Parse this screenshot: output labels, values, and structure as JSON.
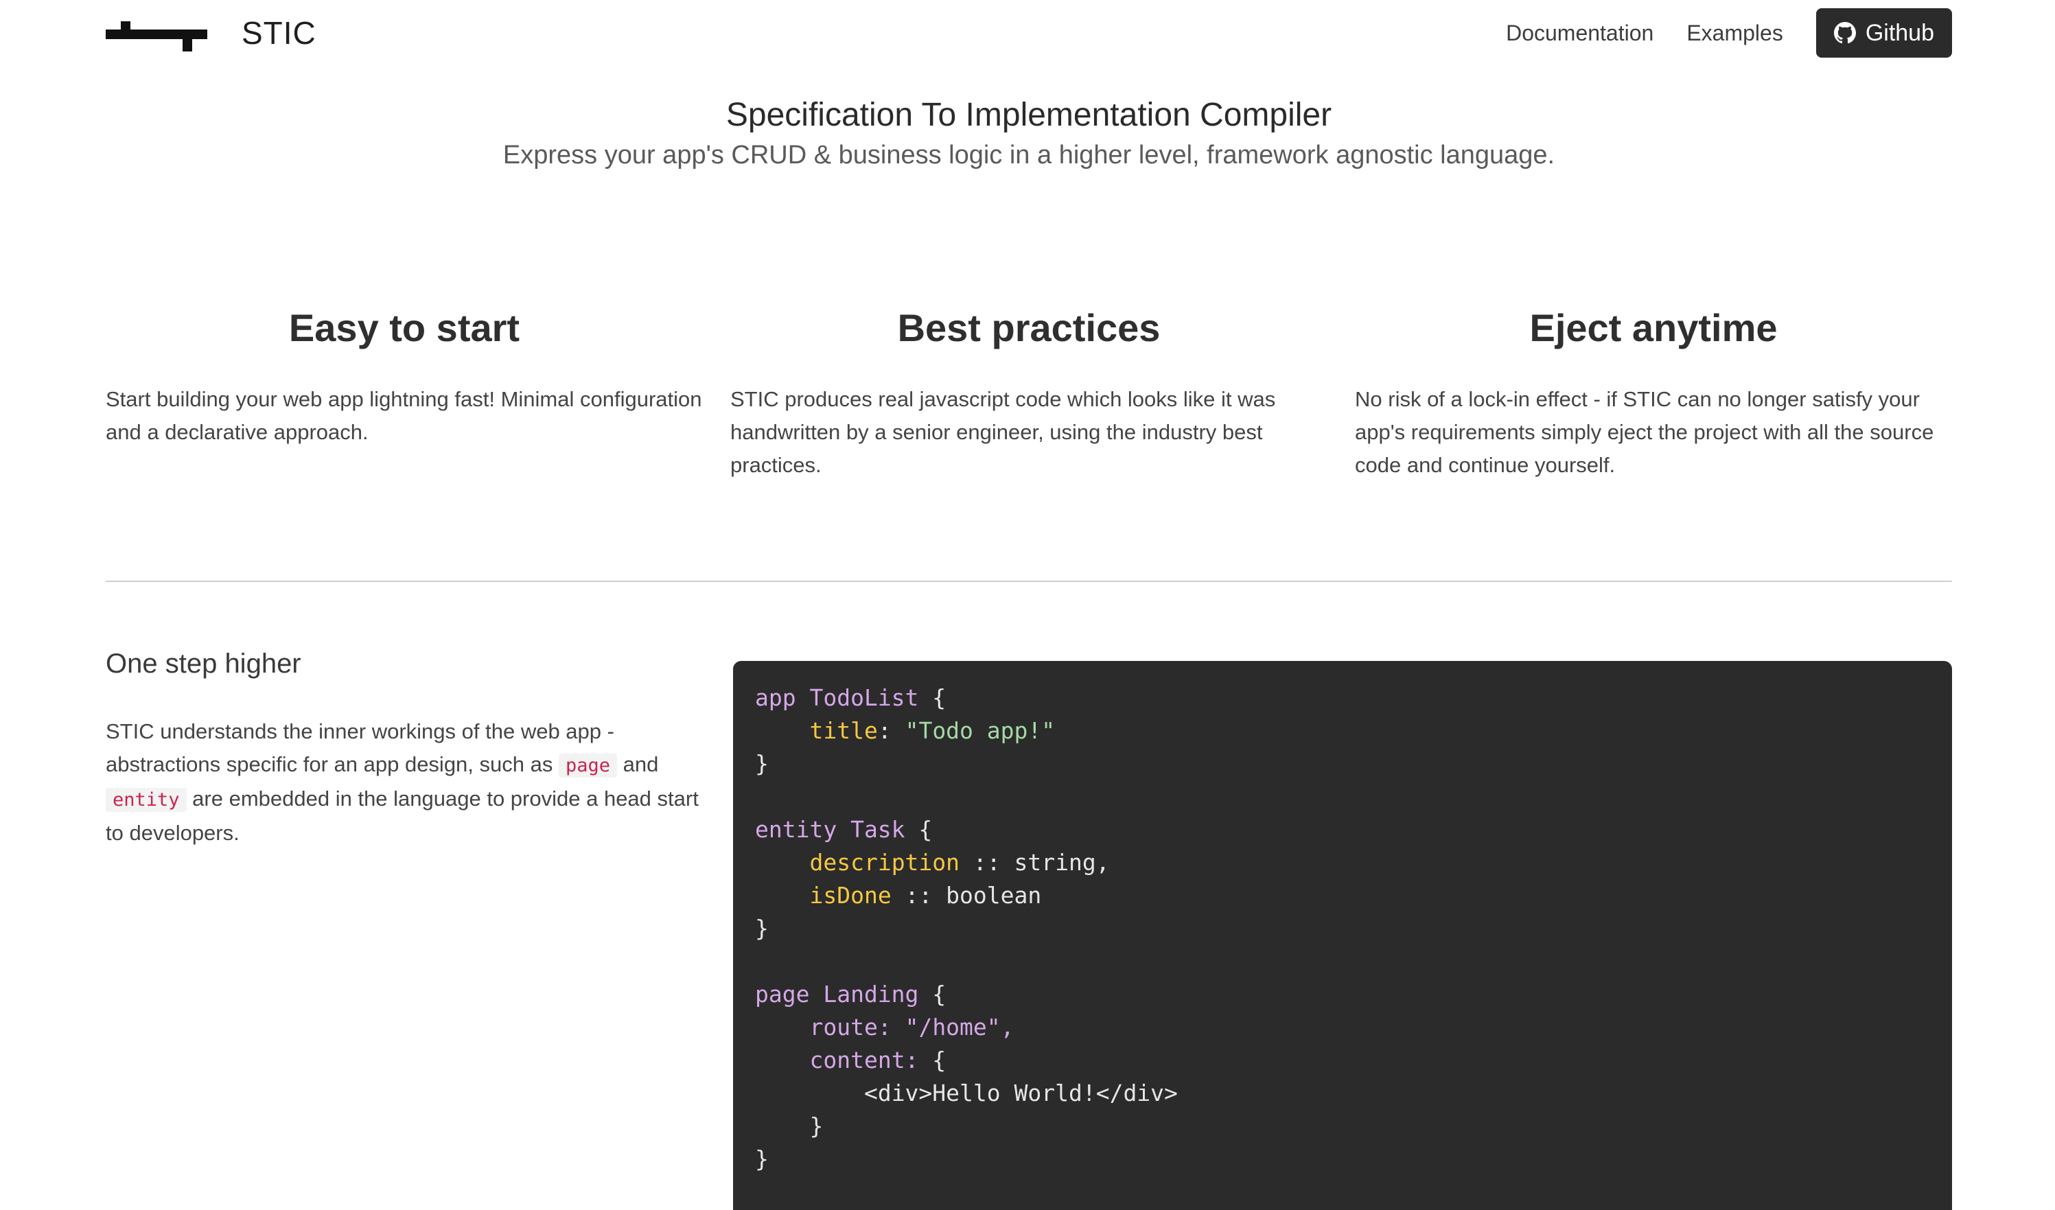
{
  "nav": {
    "brand": "STIC",
    "links": [
      "Documentation",
      "Examples"
    ],
    "github_label": "Github"
  },
  "hero": {
    "title": "Specification To Implementation Compiler",
    "subtitle": "Express your app's CRUD & business logic in a higher level, framework agnostic language."
  },
  "features": [
    {
      "title": "Easy to start",
      "text": "Start building your web app lightning fast! Minimal configuration and a declarative approach."
    },
    {
      "title": "Best practices",
      "text": "STIC produces real javascript code which looks like it was handwritten by a senior engineer, using the industry best practices."
    },
    {
      "title": "Eject anytime",
      "text": "No risk of a lock-in effect - if STIC can no longer satisfy your app's requirements simply eject the project with all the source code and continue yourself."
    }
  ],
  "section": {
    "title": "One step higher",
    "text_1": "STIC understands the inner workings of the web app - abstractions specific for an app design, such as",
    "code_1": "page",
    "text_2": "and",
    "code_2": "entity",
    "text_3": "are embedded in the language to provide a head start to developers."
  },
  "code": {
    "app_kw": "app TodoList",
    "title_prop": "title",
    "title_val": "\"Todo app!\"",
    "entity_kw": "entity Task",
    "desc_prop": "description",
    "desc_type": ":: string,",
    "done_prop": "isDone",
    "done_type": ":: boolean",
    "page_kw": "page Landing",
    "route_key": "route:",
    "route_val": "\"/home\",",
    "content_key": "content:",
    "content_val": "<div>Hello World!</div>"
  },
  "colors": {
    "code_bg": "#2b2b2b",
    "keyword": "#d5a7e8",
    "property": "#f5c842",
    "string": "#a6d9a5",
    "inline_code": "#c7254e"
  },
  "icons": {
    "github": "github-icon",
    "logo": "stic-logo-icon"
  }
}
